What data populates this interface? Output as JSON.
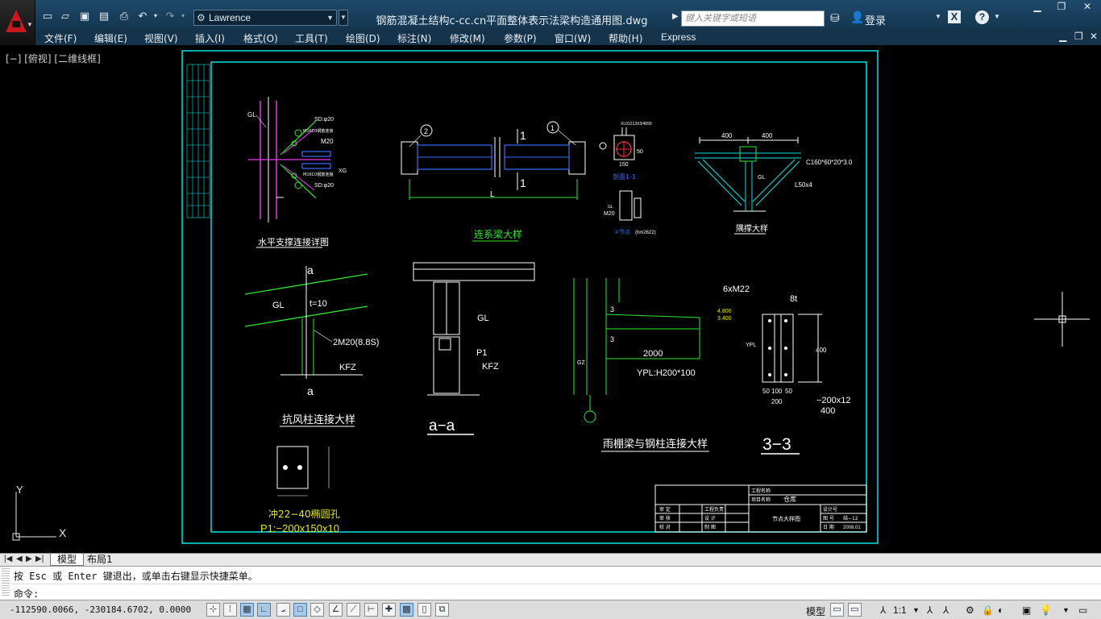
{
  "titlebar": {
    "workspace": "Lawrence",
    "document_title": "钢筋混凝土结构c-cc.cn平面整体表示法梁构造通用图.dwg",
    "search_placeholder": "键入关键字或短语",
    "login_label": "登录"
  },
  "menu": {
    "items": [
      "文件(F)",
      "编辑(E)",
      "视图(V)",
      "插入(I)",
      "格式(O)",
      "工具(T)",
      "绘图(D)",
      "标注(N)",
      "修改(M)",
      "参数(P)",
      "窗口(W)",
      "帮助(H)",
      "Express"
    ]
  },
  "viewport": {
    "label": "[−] [俯视] [二维线框]"
  },
  "drawing": {
    "colors": {
      "frame": "#00e5e5",
      "text": "#ffffff",
      "green": "#2ee62e",
      "magenta": "#e639e6",
      "yellow": "#e6e61a",
      "blue": "#3a6bff",
      "red": "#ff3030"
    },
    "d1": {
      "title": "水平支撑连接详图",
      "gl": "GL",
      "l1": "SD:φ20",
      "l2": "M16C0钢筋连接",
      "l3": "M20",
      "l4": "M16C0钢筋连接",
      "l5": "XG",
      "l6": "SD:φ20"
    },
    "d2": {
      "title": "连系梁大样",
      "n1": "2",
      "n2": "1",
      "dim": "L"
    },
    "d3": {
      "top": "XL01213X3/4899",
      "sec": "剖面1-1",
      "caption": "①节点",
      "sub": "(hm2622)",
      "m20": "M20",
      "gl": "GL",
      "c1": "50",
      "c2": "150"
    },
    "d4": {
      "title": "隅撑大样",
      "dim1": "400",
      "dim2": "400",
      "c160": "C160*60*20*3.0",
      "l50": "L50x4",
      "gl": "GL"
    },
    "d5": {
      "title": "抗风柱连接大样",
      "a": "a",
      "gl": "GL",
      "t": "t=10",
      "bolt": "2M20(8.8S)",
      "kfz": "KFZ"
    },
    "d6": {
      "title": "a−a",
      "gl": "GL",
      "p1": "P1",
      "kfz": "KFZ"
    },
    "d7": {
      "title": "雨棚梁与钢柱连接大样",
      "gz": "GZ",
      "dim": "2000",
      "ypl": "YPL:H200*100",
      "elev1": "4.800",
      "elev2": "3.400",
      "n3": "3"
    },
    "d8": {
      "title": "3−3",
      "bolts": "6xM22",
      "t8": "8t",
      "ypl": "YPL",
      "plate": "−200x12",
      "w400": "400",
      "dims": [
        "50",
        "100",
        "50"
      ],
      "dimw": "200",
      "dimh": "400"
    },
    "d9": {
      "caption": "冲22−40椭圆孔",
      "plate": "P1:−200x150x10"
    },
    "titleblock": {
      "r1": "工程名称",
      "r2": "项目名称",
      "proj": "仓库",
      "sheet": "节点大样图",
      "left": [
        "审 定",
        "审 核",
        "校 对"
      ],
      "mid": [
        "工程负责",
        "设 计",
        "制 图"
      ],
      "right": [
        "设计号",
        "图 号",
        "结−12",
        "日 期",
        "2008.01"
      ]
    }
  },
  "tabs": {
    "model": "模型",
    "layout1": "布局1"
  },
  "command": {
    "history": "按 Esc 或 Enter 键退出，或单击右键显示快捷菜单。",
    "prompt": "命令:"
  },
  "status": {
    "coordinates": "-112590.0066, -230184.6702, 0.0000",
    "model_label": "模型",
    "annotation_scale": "1:1"
  },
  "ucs": {
    "x": "X",
    "y": "Y"
  }
}
